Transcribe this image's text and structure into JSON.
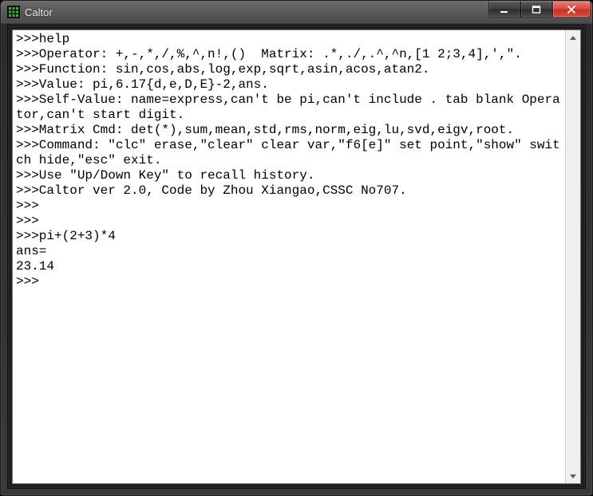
{
  "window": {
    "title": "Caltor"
  },
  "console": {
    "lines": [
      ">>>help",
      ">>>Operator: +,-,*,/,%,^,n!,()  Matrix: .*,./,.^,^n,[1 2;3,4],',\".",
      ">>>Function: sin,cos,abs,log,exp,sqrt,asin,acos,atan2.",
      ">>>Value: pi,6.17{d,e,D,E}-2,ans.",
      ">>>Self-Value: name=express,can't be pi,can't include . tab blank Operator,can't start digit.",
      ">>>Matrix Cmd: det(*),sum,mean,std,rms,norm,eig,lu,svd,eigv,root.",
      ">>>Command: \"clc\" erase,\"clear\" clear var,\"f6[e]\" set point,\"show\" switch hide,\"esc\" exit.",
      ">>>Use \"Up/Down Key\" to recall history.",
      ">>>Caltor ver 2.0, Code by Zhou Xiangao,CSSC No707.",
      ">>>",
      ">>>",
      ">>>pi+(2+3)*4",
      "ans=",
      "23.14",
      ">>>"
    ]
  }
}
